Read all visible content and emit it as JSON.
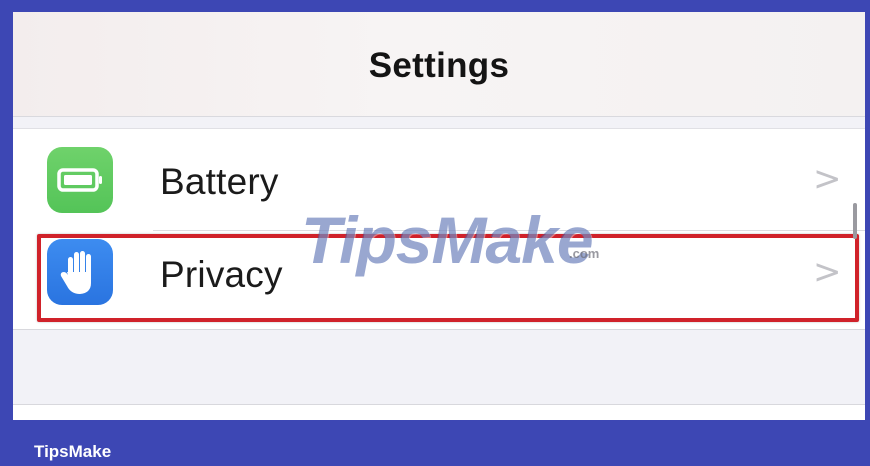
{
  "nav": {
    "title": "Settings"
  },
  "rows": [
    {
      "label": "Battery",
      "icon": "battery-icon",
      "icon_color": "#5ac85a"
    },
    {
      "label": "Privacy",
      "icon": "hand-raised-icon",
      "icon_color": "#3380ea"
    }
  ],
  "chevron": ">",
  "highlight_color": "#d0222a",
  "watermark": {
    "brand": "TipsMake",
    "domain": ".com"
  },
  "footer": {
    "brand": "TipsMake"
  },
  "colors": {
    "frame": "#3d47b4",
    "background": "#f2f2f7",
    "cell": "#ffffff"
  }
}
